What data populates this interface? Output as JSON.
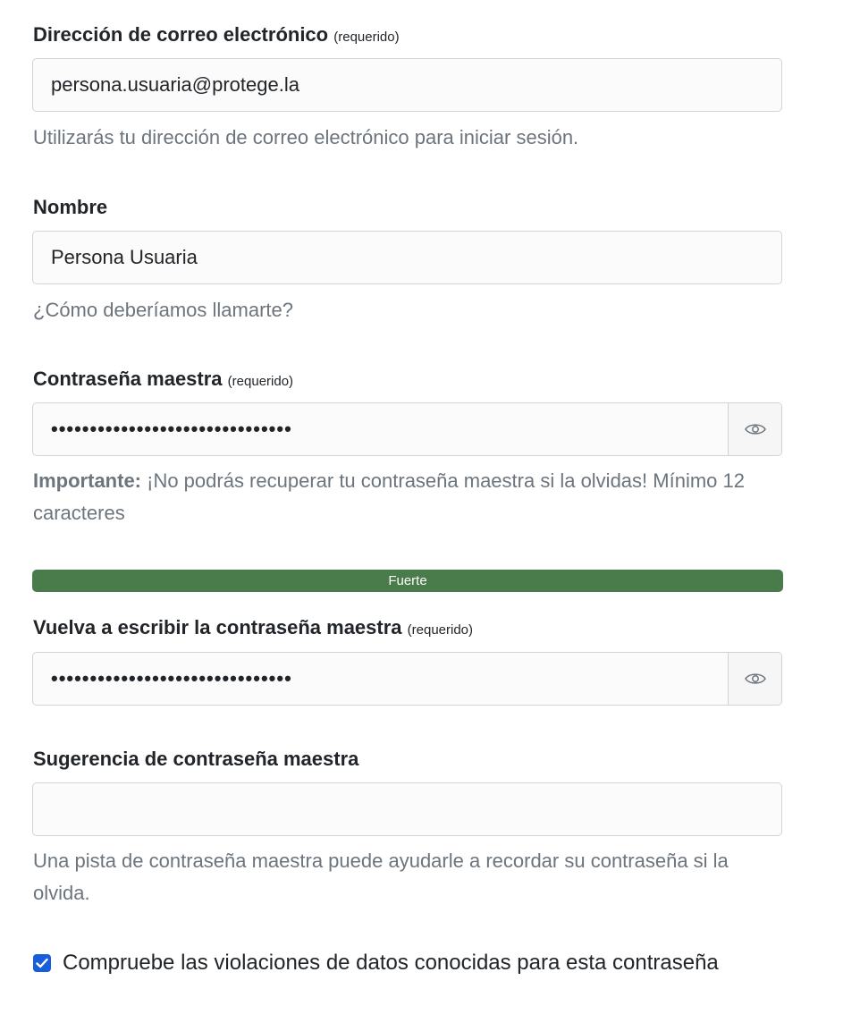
{
  "email": {
    "label": "Dirección de correo electrónico",
    "required": "(requerido)",
    "value": "persona.usuaria@protege.la",
    "help": "Utilizarás tu dirección de correo electrónico para iniciar sesión."
  },
  "name": {
    "label": "Nombre",
    "value": "Persona Usuaria",
    "help": "¿Cómo deberíamos llamarte?"
  },
  "master_password": {
    "label": "Contraseña maestra",
    "required": "(requerido)",
    "value": "•••••••••••••••••••••••••••••••",
    "help_strong": "Importante:",
    "help": " ¡No podrás recuperar tu contraseña maestra si la olvidas! Mínimo 12 caracteres",
    "strength_label": "Fuerte",
    "toggle_icon": "eye-icon"
  },
  "retype_password": {
    "label": "Vuelva a escribir la contraseña maestra",
    "required": "(requerido)",
    "value": "•••••••••••••••••••••••••••••••",
    "toggle_icon": "eye-icon"
  },
  "hint": {
    "label": "Sugerencia de contraseña maestra",
    "value": "",
    "help": "Una pista de contraseña maestra puede ayudarle a recordar su contraseña si la olvida."
  },
  "breach_check": {
    "checked": true,
    "label": "Compruebe las violaciones de datos conocidas para esta contraseña"
  },
  "colors": {
    "strength_bar": "#4a7b4a",
    "checkbox": "#175ddc",
    "help_text": "#6c757d"
  }
}
